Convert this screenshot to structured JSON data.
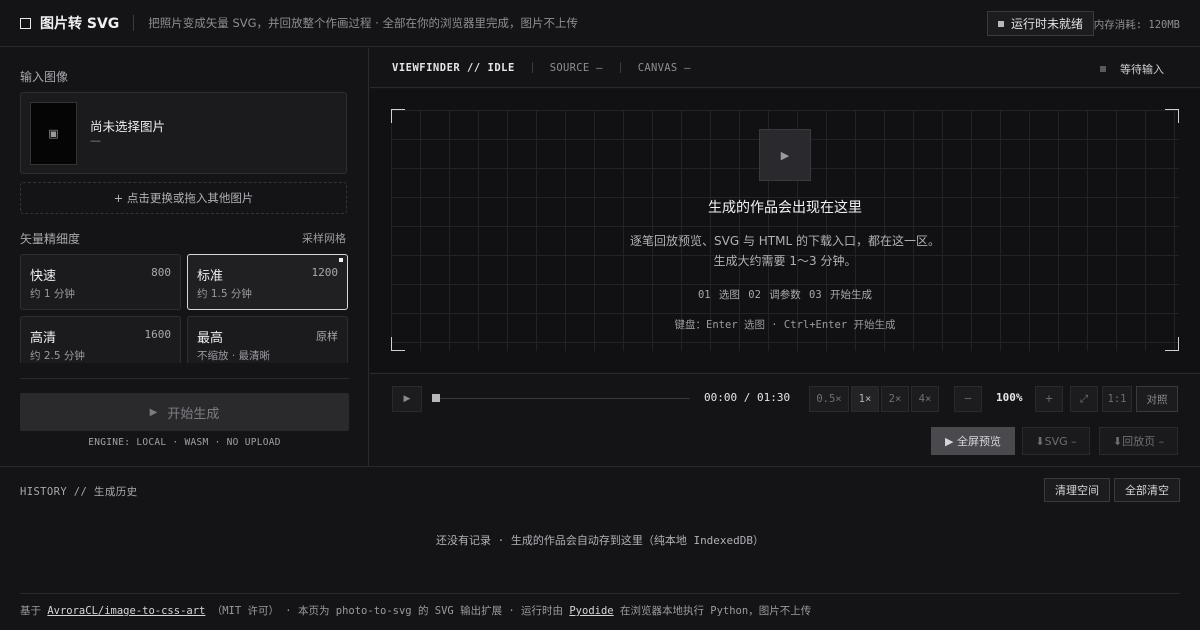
{
  "header": {
    "app_title": "图片转 SVG",
    "tagline": "把照片变成矢量 SVG，并回放整个作画过程 · 全部在你的浏览器里完成，图片不上传",
    "runtime_status": "运行时未就绪",
    "memory": "内存消耗: 120MB"
  },
  "left": {
    "input_label": "输入图像",
    "image_name": "尚未选择图片",
    "image_sub": "—",
    "thumb_glyph": "▣",
    "replace_label": "+ 点击更换或拖入其他图片",
    "detail_label": "矢量精细度",
    "grid_link": "采样网格",
    "options": [
      {
        "name": "快速",
        "value": "800",
        "time": "约 1 分钟"
      },
      {
        "name": "标准",
        "value": "1200",
        "time": "约 1.5 分钟"
      },
      {
        "name": "高清",
        "value": "1600",
        "time": "约 2.5 分钟"
      },
      {
        "name": "最高",
        "value": "原样",
        "time": "不缩放 · 最清晰"
      }
    ],
    "selected_option": "标准",
    "generate_label": "开始生成",
    "generate_icon": "▶",
    "engine_note": "ENGINE: LOCAL · WASM · NO UPLOAD"
  },
  "viewfinder": {
    "title": "VIEWFINDER // IDLE",
    "source": "SOURCE —",
    "canvas": "CANVAS —",
    "status": "等待输入",
    "play_glyph": "▶",
    "heading": "生成的作品会出现在这里",
    "desc_line1": "逐笔回放预览、SVG 与 HTML 的下载入口，都在这一区。",
    "desc_line2": "生成大约需要 1～3 分钟。",
    "steps": "01 选图  02 调参数  03 开始生成",
    "keys": "键盘：Enter 选图 · Ctrl+Enter 开始生成"
  },
  "player": {
    "play_glyph": "▶",
    "time": "00:00 / 01:30",
    "progress": 0,
    "speeds": [
      "0.5×",
      "1×",
      "2×",
      "4×"
    ],
    "zoom_out": "−",
    "zoom": "100%",
    "zoom_in": "+",
    "fit_glyph": "⤢",
    "actual_size": "1:1",
    "compare": "对照",
    "fullscreen": "▶ 全屏预览",
    "download_svg": "⬇SVG –",
    "download_replay": "⬇回放页 –"
  },
  "history": {
    "label": "HISTORY // 生成历史",
    "clean_space": "清理空间",
    "clear_all": "全部清空",
    "empty": "还没有记录 · 生成的作品会自动存到这里（纯本地 IndexedDB）"
  },
  "footer": {
    "prefix": "基于",
    "repo": "AvroraCL/image-to-css-art",
    "license": "（MIT 许可） · 本页为 photo-to-svg 的 SVG 输出扩展 · 运行时由",
    "runtime": "Pyodide",
    "suffix": "在浏览器本地执行 Python，图片不上传"
  }
}
